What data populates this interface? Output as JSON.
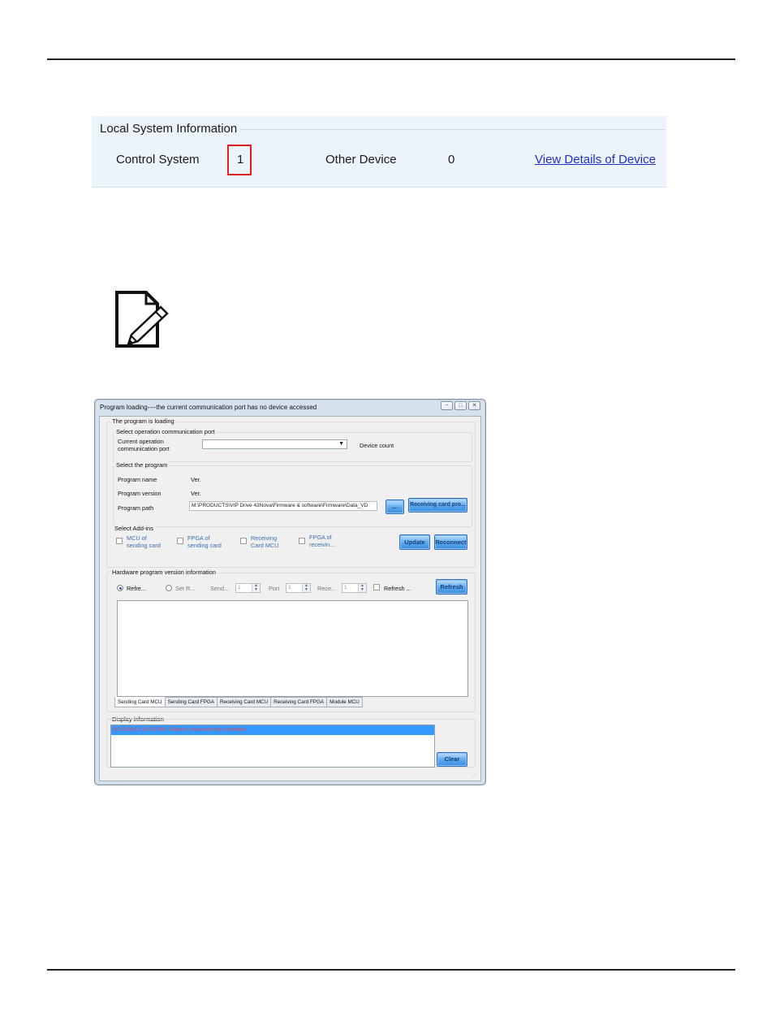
{
  "lsi": {
    "legend": "Local System Information",
    "control_label": "Control System",
    "control_value": "1",
    "other_label": "Other Device",
    "other_value": "0",
    "details_link": "View Details of Device"
  },
  "dialog": {
    "title": "Program loading----the current communication port has no device accessed",
    "controls": {
      "minimize": "−",
      "maximize": "□",
      "close": "✕"
    },
    "group_loading": "The program is loading",
    "group_comm": "Select operation communication port",
    "current_port_label": "Current operation communication port",
    "device_count_label": "Device count",
    "group_program": "Select the program",
    "program_name_label": "Program name",
    "program_name_value": "Ver.",
    "program_version_label": "Program version",
    "program_version_value": "Ver.",
    "program_path_label": "Program path",
    "program_path_value": "M:\\PRODUCTS\\VIP Drive 43Nova\\Firmware & software\\Firmware\\Data_VD",
    "browse_button": "....",
    "receiving_button": "Receiving card pro...",
    "group_addins": "Select Add-ins",
    "addins": [
      "MCU of sending card",
      "FPGA of sending card",
      "Receiving Card MCU",
      "FPGA of receivin..."
    ],
    "update_button": "Update",
    "reconnect_button": "Reconnect",
    "group_hw": "Hardware program version information",
    "radio_refresh": "Refre...",
    "radio_set": "Set R...",
    "send_label": "Send...",
    "send_value": "1",
    "port_label": "Port",
    "port_value": "1",
    "rece_label": "Rece...",
    "rece_value": "1",
    "refresh_check": "Refresh ...",
    "refresh_button": "Refresh",
    "tabs": [
      "Sending Card MCU",
      "Sending Card FPGA",
      "Receiving Card MCU",
      "Receiving Card FPGA",
      "Module MCU"
    ],
    "group_display": "Display information",
    "log_entry": "5/13/2016 2:31:35 PM--Failed to reconnect the controller!",
    "clear_button": "Clear"
  }
}
